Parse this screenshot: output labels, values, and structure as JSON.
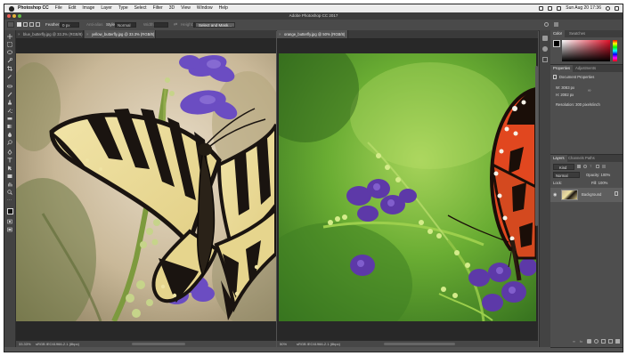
{
  "menubar": {
    "app": "Photoshop CC",
    "menus": [
      "File",
      "Edit",
      "Image",
      "Layer",
      "Type",
      "Select",
      "Filter",
      "3D",
      "View",
      "Window",
      "Help"
    ],
    "clock": "Sun Aug 20 17:36"
  },
  "window": {
    "title": "Adobe Photoshop CC 2017"
  },
  "options": {
    "feather_label": "Feather:",
    "feather_value": "0 px",
    "antialias": "Anti-alias",
    "style_label": "Style:",
    "style_value": "Normal",
    "width_label": "Width:",
    "height_label": "Height:",
    "select_mask": "Select and Mask..."
  },
  "documents": {
    "left": {
      "tab_inactive": "blue_butterfly.jpg @ 33.3% (RGB/8)",
      "tab_active": "yellow_butterfly.jpg @ 33.3% (RGB/8)",
      "zoom": "33.33%",
      "info": "sRGB IEC61966-2.1 (8bpc)"
    },
    "right": {
      "tab": "orange_butterfly.jpg @ 50% (RGB/8)",
      "zoom": "50%",
      "info": "sRGB IEC61966-2.1 (8bpc)"
    }
  },
  "panels": {
    "color_tabs": [
      "Color",
      "Swatches"
    ],
    "properties_tabs": [
      "Properties",
      "Adjustments"
    ],
    "doc_properties_title": "Document Properties",
    "width": "W: 3083 px",
    "height": "H: 2082 px",
    "resolution": "Resolution: 300 pixels/inch",
    "layers_tabs": [
      "Layers",
      "Channels",
      "Paths"
    ],
    "kind": "Kind",
    "blend_mode": "Normal",
    "opacity": "Opacity: 100%",
    "lock": "Lock:",
    "fill": "Fill: 100%",
    "layer_name": "Background"
  },
  "colors": {
    "ui_dark": "#535353",
    "accent_violet": "#6b3fb8",
    "butterfly_yellow": "#ede0a0",
    "butterfly_orange": "#e0451f"
  }
}
